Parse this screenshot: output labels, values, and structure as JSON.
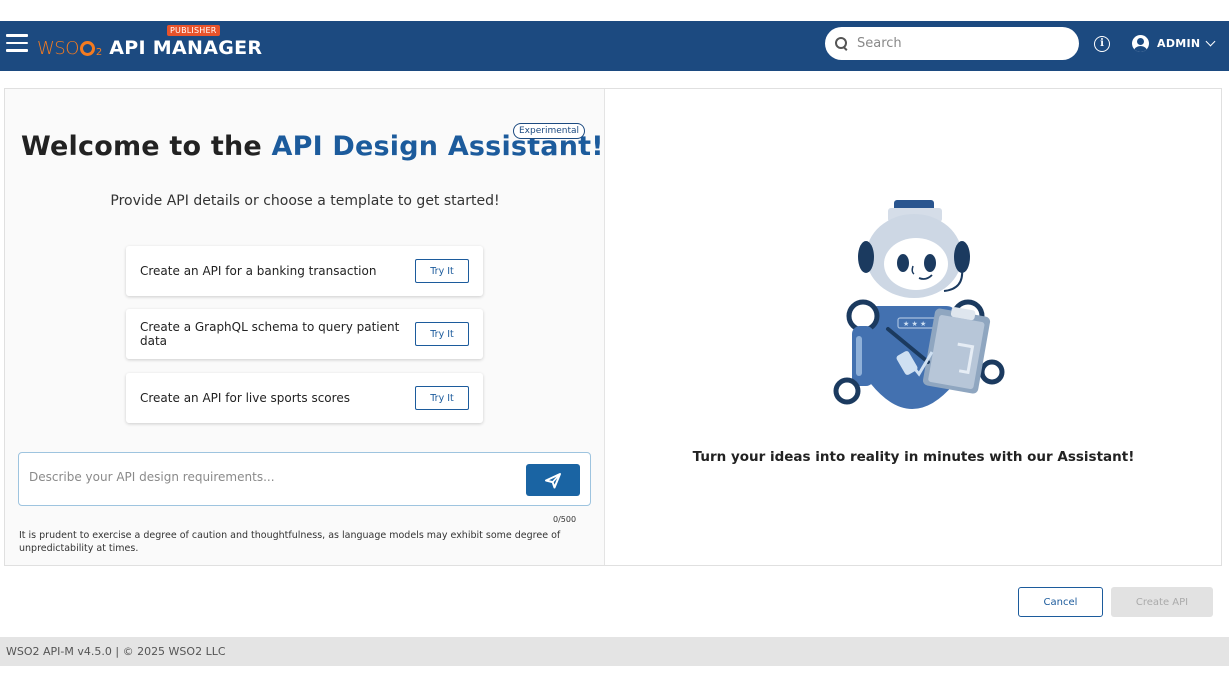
{
  "header": {
    "logo_text": "WSO",
    "logo_subscript": "2",
    "product_title": "API MANAGER",
    "portal_badge": "PUBLISHER",
    "search_placeholder": "Search",
    "user_label": "ADMIN",
    "icons": [
      "menu-icon",
      "search-icon",
      "info-icon",
      "account-icon",
      "chevron-down-icon"
    ]
  },
  "assistant": {
    "title_prefix": "Welcome to the ",
    "title_accent": "API Design Assistant!",
    "experimental_badge": "Experimental",
    "subtitle": "Provide API details or choose a template to get started!",
    "templates": [
      {
        "label": "Create an API for a banking transaction",
        "button": "Try It"
      },
      {
        "label": "Create a GraphQL schema to query patient data",
        "button": "Try It"
      },
      {
        "label": "Create an API for live sports scores",
        "button": "Try It"
      }
    ],
    "input_placeholder": "Describe your API design requirements...",
    "char_counter": "0/500",
    "disclaimer": "It is prudent to exercise a degree of caution and thoughtfulness, as language models may exhibit some degree of unpredictability at times.",
    "tagline": "Turn your ideas into reality in minutes with our Assistant!"
  },
  "actions": {
    "cancel_label": "Cancel",
    "create_label": "Create API"
  },
  "footer": {
    "text": "WSO2 API-M v4.5.0 | © 2025 WSO2 LLC"
  },
  "colors": {
    "header_bg": "#1c4a80",
    "accent": "#1c5b9c",
    "send_button": "#1a64a3",
    "logo_orange": "#f47b20"
  }
}
